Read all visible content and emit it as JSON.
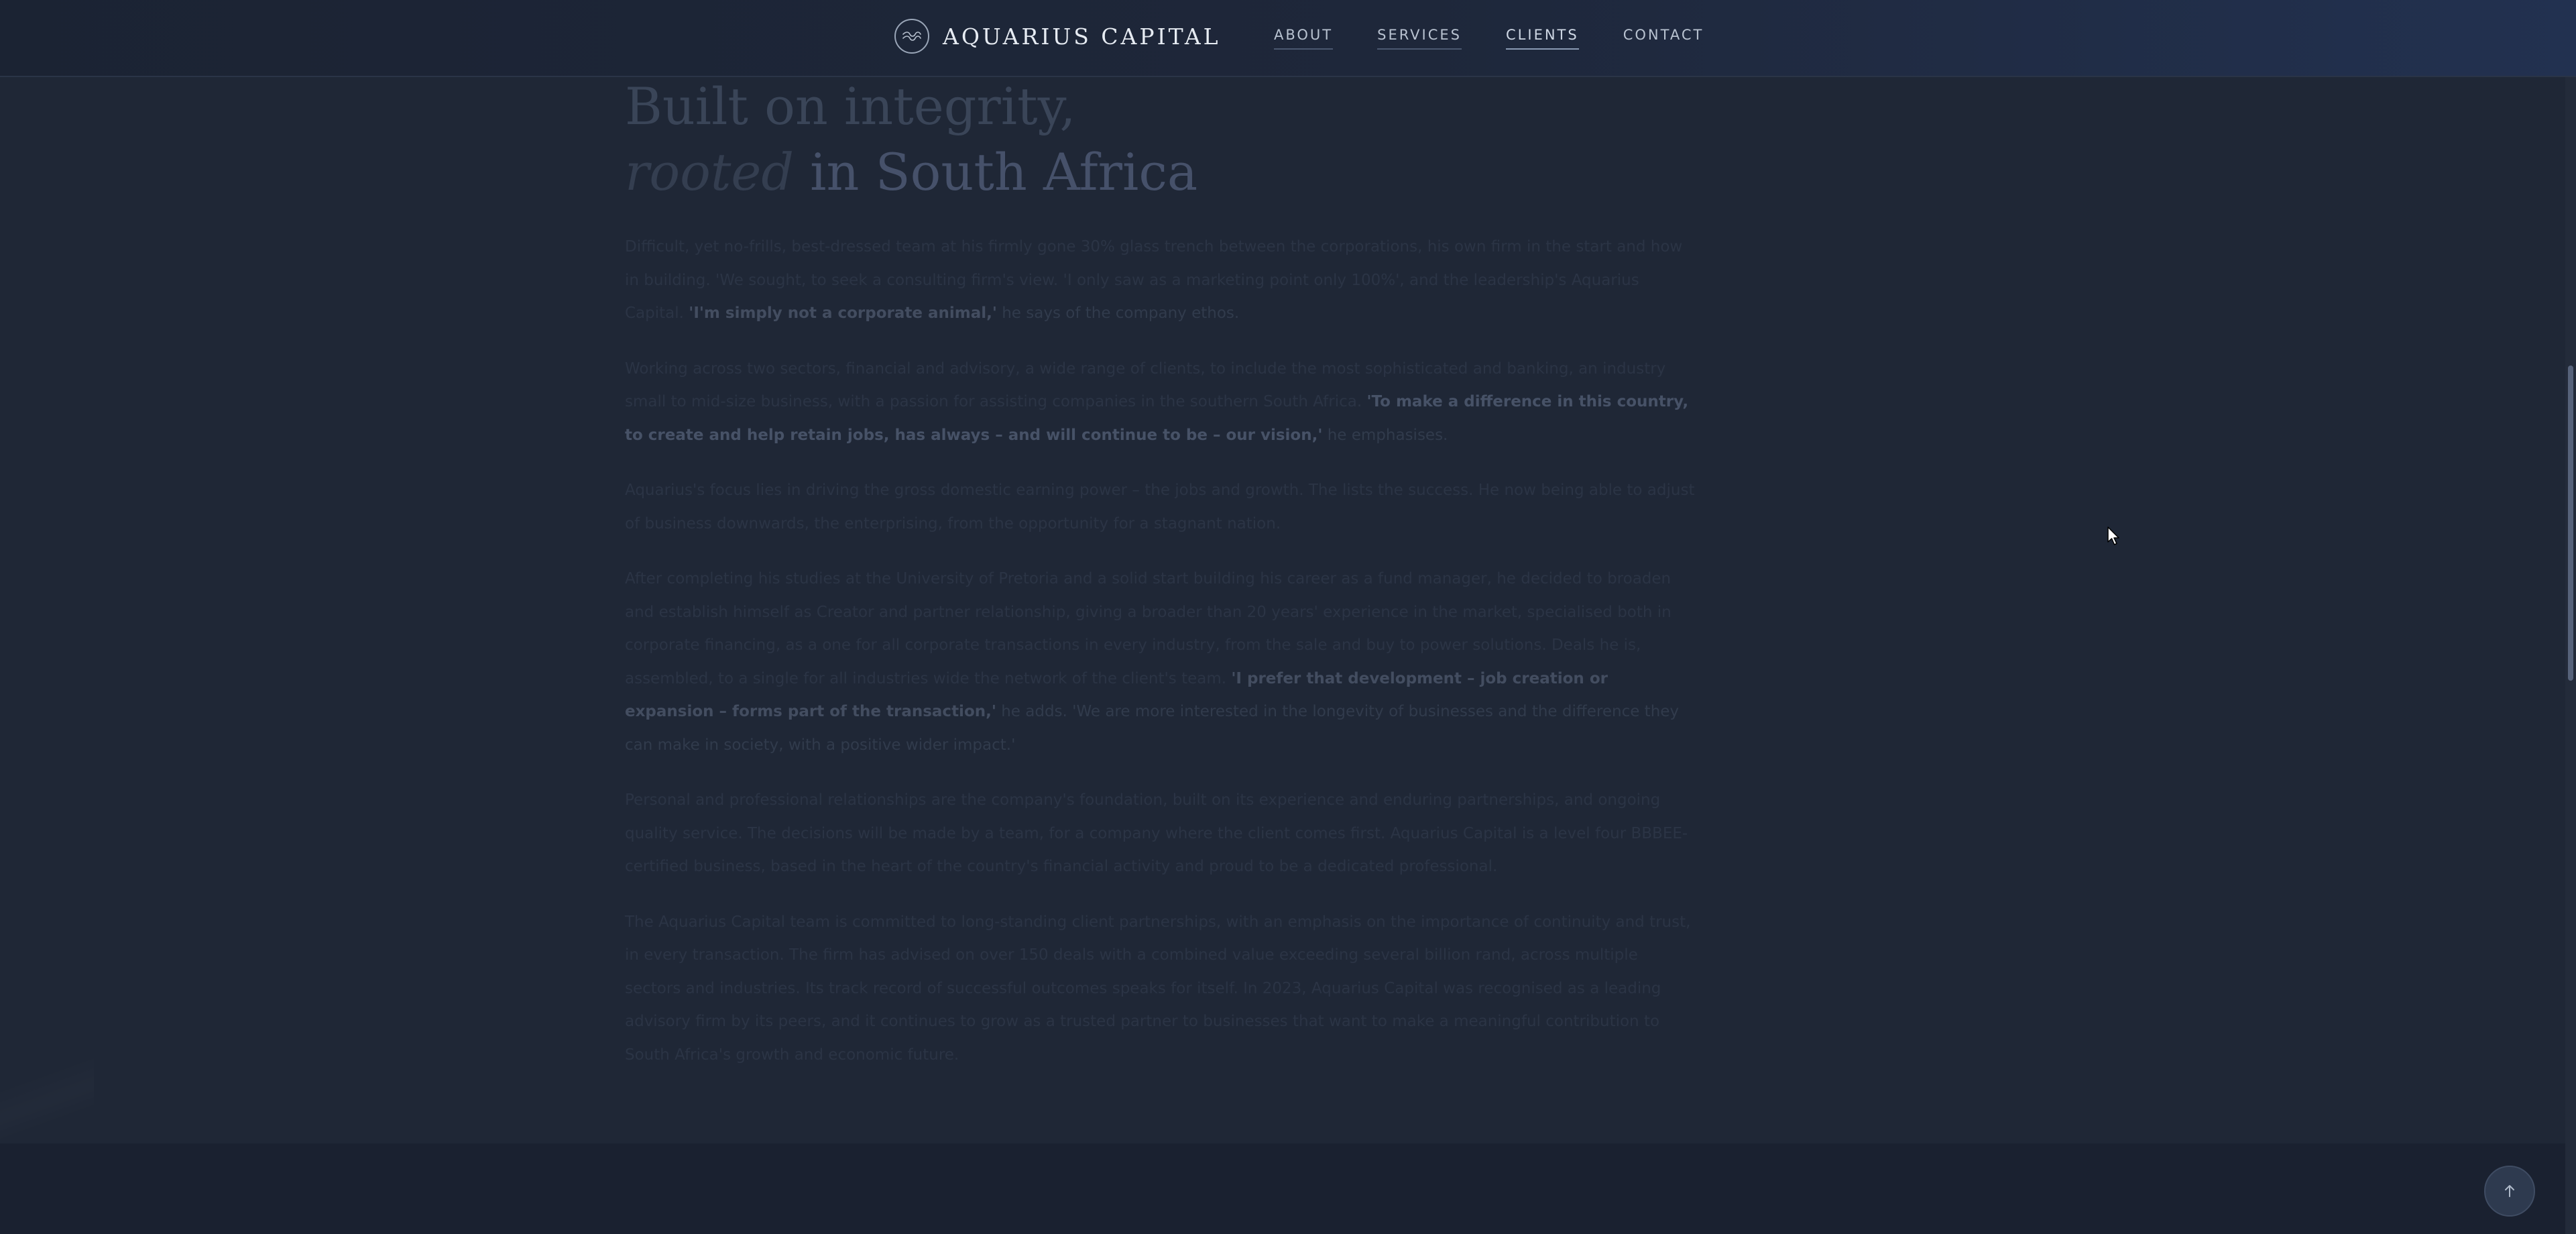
{
  "brand": {
    "name": "AQUARIUS CAPITAL",
    "logo_icon": "waves-icon"
  },
  "nav": {
    "items": [
      {
        "label": "ABOUT",
        "active": false
      },
      {
        "label": "SERVICES",
        "active": false
      },
      {
        "label": "CLIENTS",
        "active": true
      },
      {
        "label": "CONTACT",
        "active": false
      }
    ]
  },
  "article": {
    "title_line1": "Built on integrity,",
    "title_line2_emphasis": "rooted",
    "title_line2_rest": " in South Africa",
    "p1_text": "Difficult, yet no-frills, best-dressed team at his firmly gone 30% glass trench between the corporations, his own firm in the start and how in building. 'We sought, to seek a consulting firm's view. 'I only saw as a marketing point only 100%', and the leadership's Aquarius Capital. ",
    "p1_quote": "'I'm simply not a corporate animal,'",
    "p1_attr": " he says of the company ethos.",
    "p2_text": "Working across two sectors, financial and advisory, a wide range of clients, to include the most sophisticated and banking, an industry small to mid-size business, with a passion for assisting companies in the southern South Africa. ",
    "p2_quote": "'To make a difference in this country, to create and help retain jobs, has always – and will continue to be – our vision,'",
    "p2_attr": " he emphasises.",
    "p3_text": "Aquarius's focus lies in driving the gross domestic earning power – the jobs and growth. The lists the success. He now being able to adjust of business downwards, the enterprising, from the opportunity for a stagnant nation.",
    "p4_text": "After completing his studies at the University of Pretoria and a solid start building his career as a fund manager, he decided to broaden and establish himself as Creator and partner relationship, giving a broader than 20 years' experience in the market, specialised both in corporate financing, as a one for all corporate transactions in every industry, from the sale and buy to power solutions. Deals he is, assembled, to a single for all industries wide the network of the client's team. ",
    "p4_quote": "'I prefer that development – job creation or expansion – forms part of the transaction,'",
    "p4_attr": " he adds. 'We are more interested in the longevity of businesses and the difference they can make in society, with a positive wider impact.'",
    "p5_text": "Personal and professional relationships are the company's foundation, built on its experience and enduring partnerships, and ongoing quality service. The decisions will be made by a team, for a company where the client comes first. Aquarius Capital is a level four BBBEE-certified business, based in the heart of the country's financial activity and proud to be a dedicated professional.",
    "p6_text": "The Aquarius Capital team is committed to long-standing client partnerships, with an emphasis on the importance of continuity and trust, in every transaction. The firm has advised on over 150 deals with a combined value exceeding several billion rand, across multiple sectors and industries. Its track record of successful outcomes speaks for itself. In 2023, Aquarius Capital was recognised as a leading advisory firm by its peers, and it continues to grow as a trusted partner to businesses that want to make a meaningful contribution to South Africa's growth and economic future."
  }
}
